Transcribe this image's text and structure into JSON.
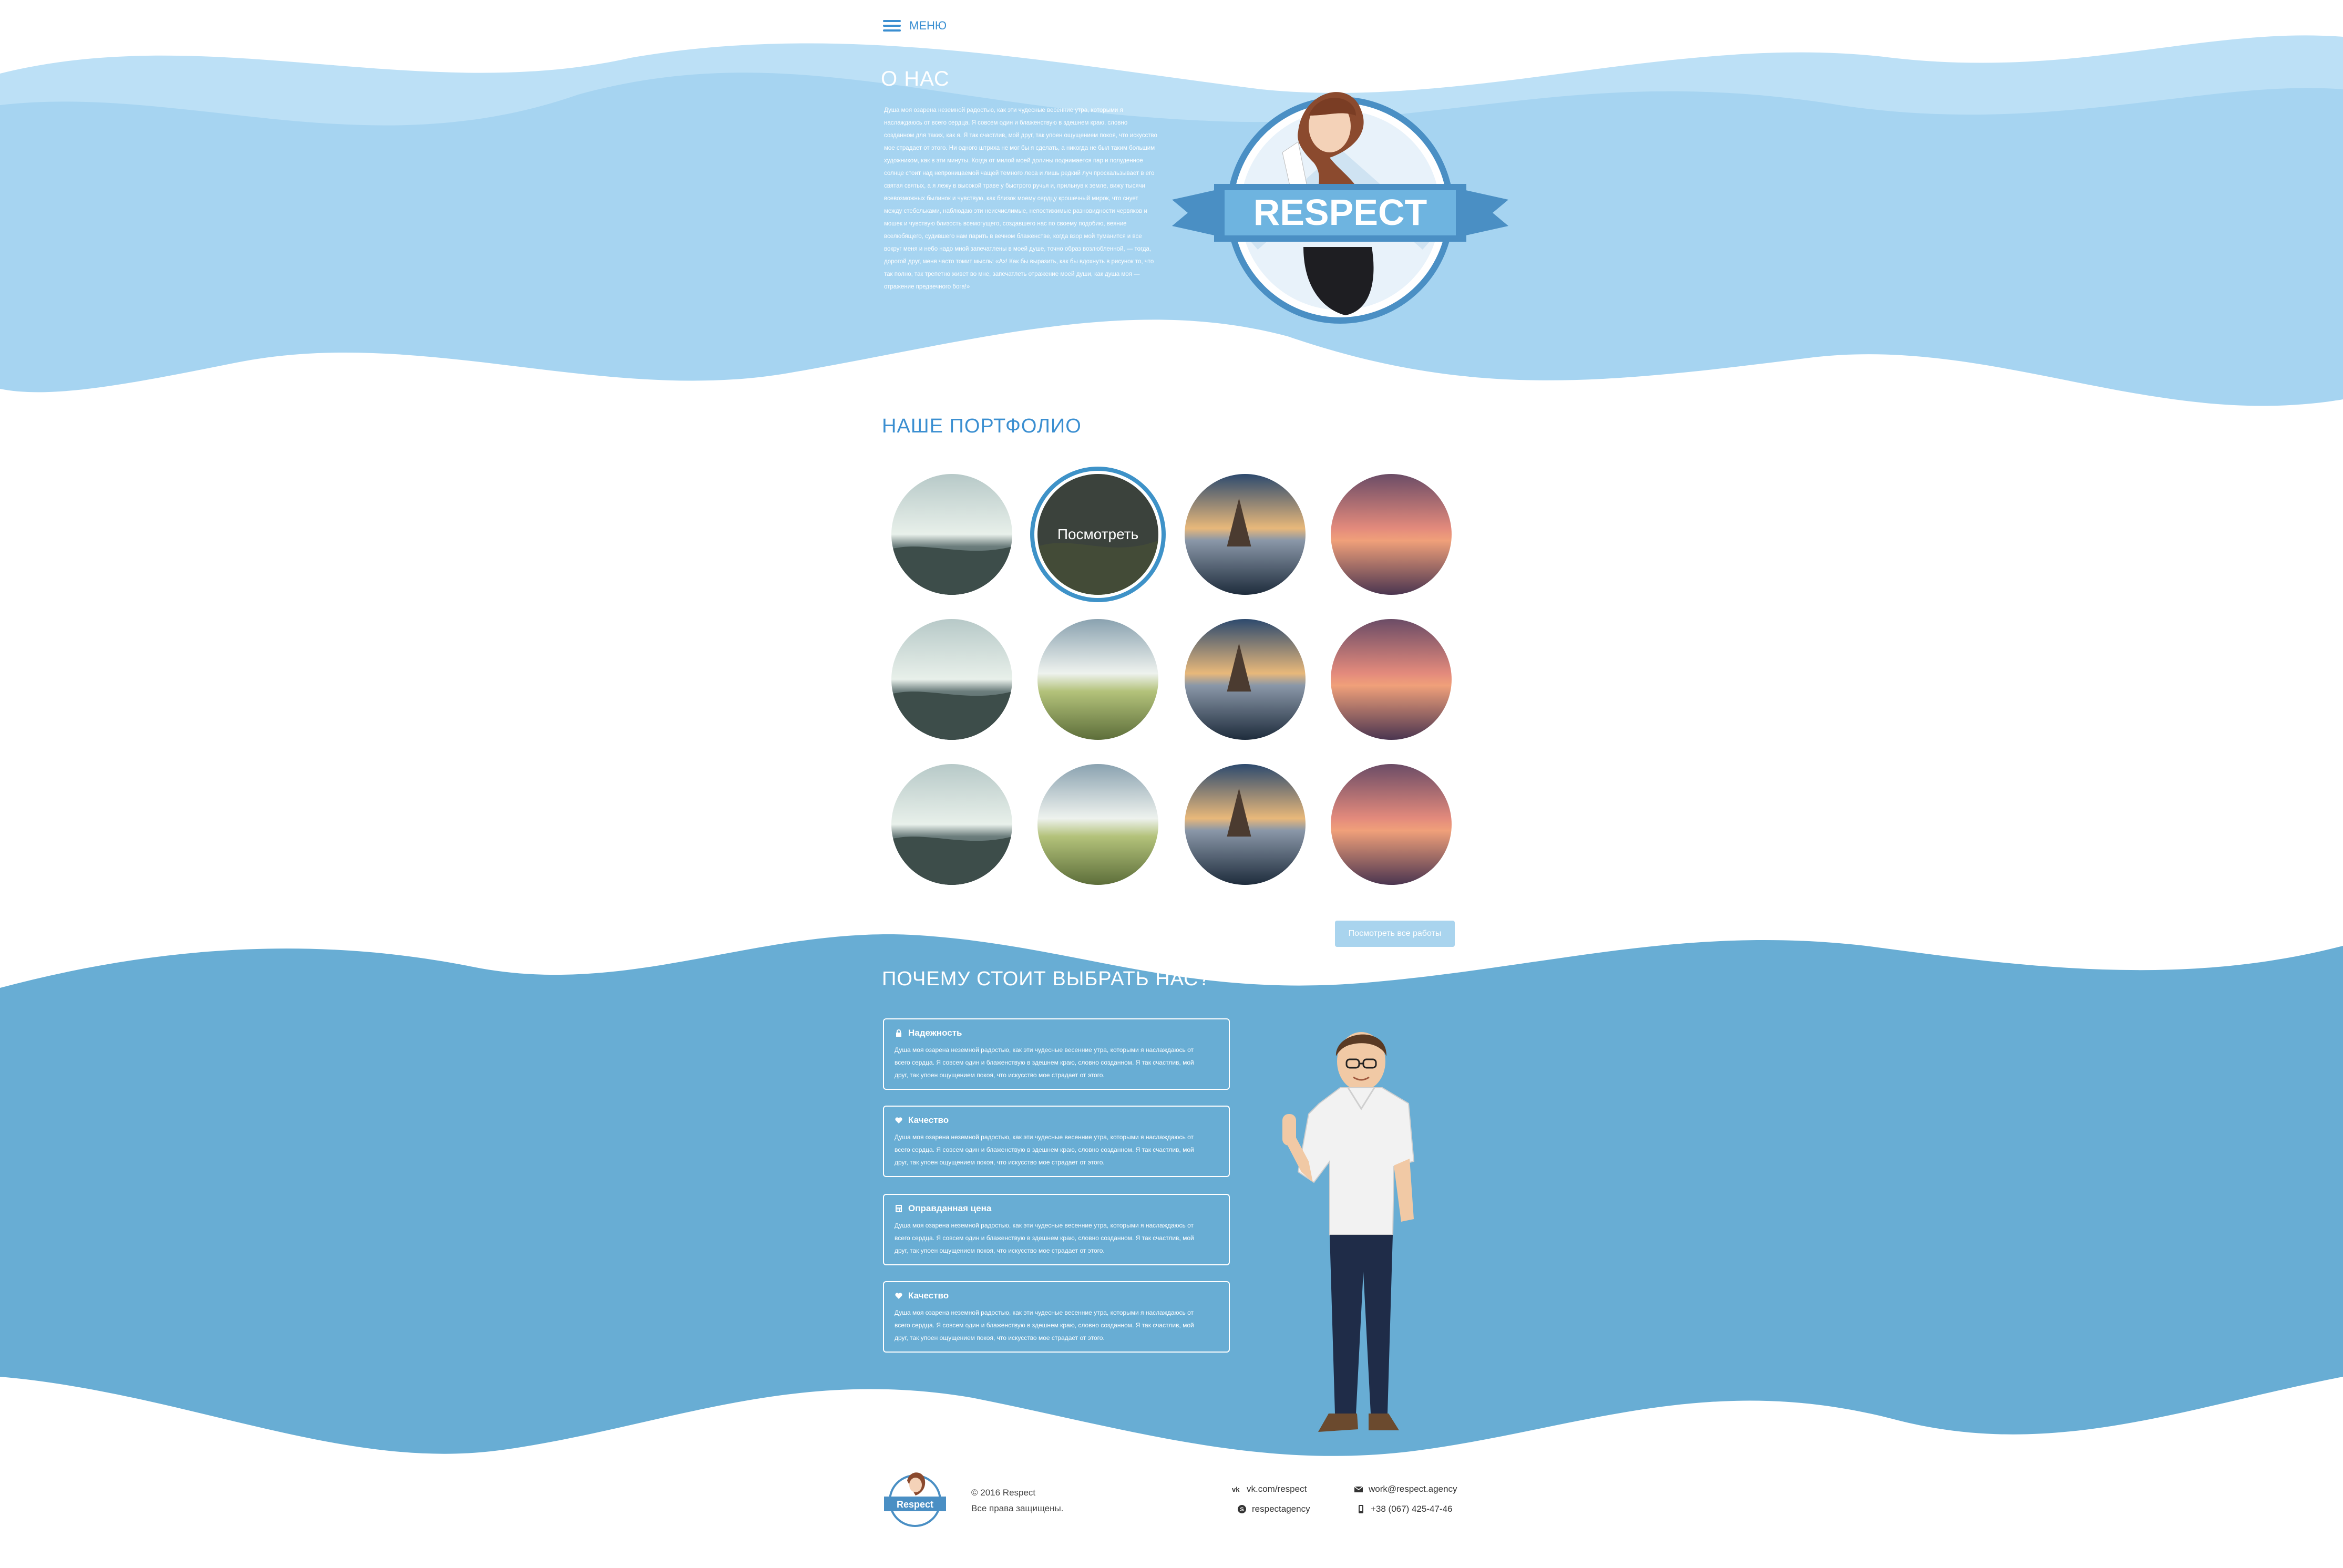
{
  "header": {
    "menu_label": "МЕНЮ"
  },
  "about": {
    "title": "О НАС",
    "text": "Душа моя озарена неземной радостью, как эти чудесные весенние утра, которыми я наслаждаюсь от всего сердца. Я совсем один и блаженствую в здешнем краю, словно созданном для таких, как я. Я так счастлив, мой друг, так упоен ощущением покоя, что искусство мое страдает от этого. Ни одного штриха не мог бы я сделать, а никогда не был таким большим художником, как в эти минуты. Когда от милой моей долины поднимается пар и полуденное солнце стоит над непроницаемой чащей темного леса и лишь редкий луч проскальзывает в его святая святых, а я лежу в высокой траве у быстрого ручья и, прильнув к земле, вижу тысячи всевозможных былинок и чувствую, как близок моему сердцу крошечный мирок, что снует между стебельками, наблюдаю эти неисчислимые, непостижимые разновидности червяков и мошек и чувствую близость всемогущего, создавшего нас по своему подобию, веяние вселюбящего, судившего нам парить в вечном блаженстве, когда взор мой туманится и все вокруг меня и небо надо мной запечатлены в моей душе, точно образ возлюбленной, — тогда, дорогой друг, меня часто томит мысль: «Ах! Как бы выразить, как бы вдохнуть в рисунок то, что так полно, так трепетно живет во мне, запечатлеть отражение моей души, как душа моя — отражение предвечного бога!»",
    "logo_text": "RESPECT"
  },
  "portfolio": {
    "title": "НАШЕ ПОРТФОЛИО",
    "view_label": "Посмотреть",
    "all_works_label": "Посмотреть все работы"
  },
  "why": {
    "title": "ПОЧЕМУ СТОИТ ВЫБРАТЬ НАС?",
    "cards": [
      {
        "title": "Надежность",
        "icon": "lock-icon",
        "text": "Душа моя озарена неземной радостью, как эти чудесные весенние утра, которыми я наслаждаюсь от всего сердца. Я совсем один и блаженствую в здешнем краю, словно созданном. Я так счастлив, мой друг, так упоен ощущением покоя, что искусство мое страдает от этого."
      },
      {
        "title": "Качество",
        "icon": "heart-icon",
        "text": "Душа моя озарена неземной радостью, как эти чудесные весенние утра, которыми я наслаждаюсь от всего сердца. Я совсем один и блаженствую в здешнем краю, словно созданном. Я так счастлив, мой друг, так упоен ощущением покоя, что искусство мое страдает от этого."
      },
      {
        "title": "Оправданная цена",
        "icon": "calculator-icon",
        "text": "Душа моя озарена неземной радостью, как эти чудесные весенние утра, которыми я наслаждаюсь от всего сердца. Я совсем один и блаженствую в здешнем краю, словно созданном. Я так счастлив, мой друг, так упоен ощущением покоя, что искусство мое страдает от этого."
      },
      {
        "title": "Качество",
        "icon": "heart-icon",
        "text": "Душа моя озарена неземной радостью, как эти чудесные весенние утра, которыми я наслаждаюсь от всего сердца. Я совсем один и блаженствую в здешнем краю, словно созданном. Я так счастлив, мой друг, так упоен ощущением покоя, что искусство мое страдает от этого."
      }
    ]
  },
  "footer": {
    "copyright": "© 2016 Respect",
    "rights": "Все права защищены.",
    "logo_text": "Respect",
    "vk": "vk.com/respect",
    "skype": "respectagency",
    "email": "work@respect.agency",
    "phone": "+38 (067) 425-47-46"
  },
  "colors": {
    "wave_light": "#a6d4f1",
    "wave_dark": "#68add4",
    "accent": "#3b8fd1"
  }
}
